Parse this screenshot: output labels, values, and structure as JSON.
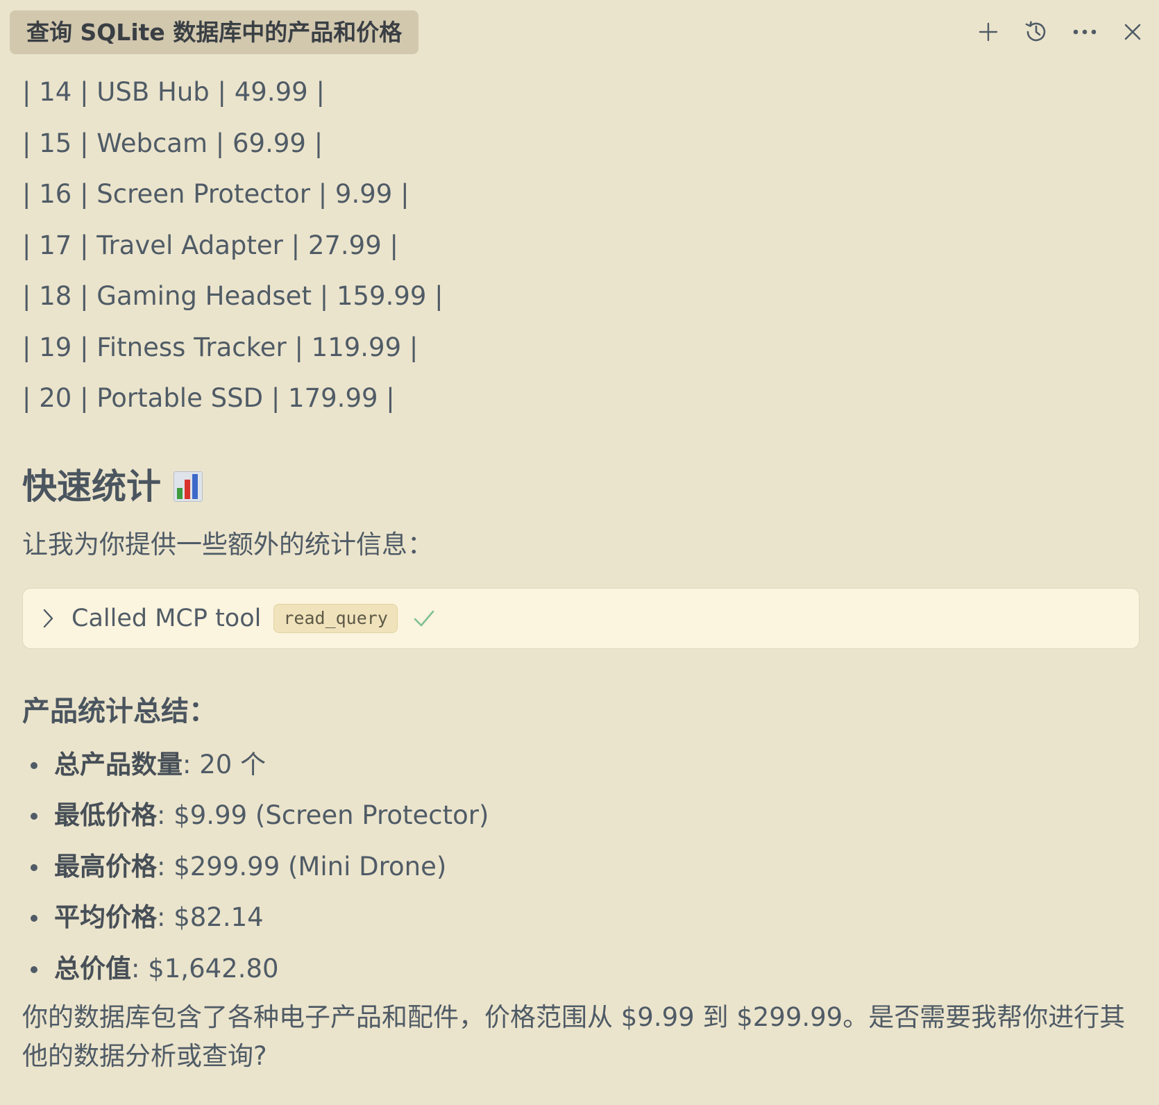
{
  "header": {
    "title": "查询 SQLite 数据库中的产品和价格",
    "icons": [
      "plus-icon",
      "history-icon",
      "more-icon",
      "close-icon"
    ]
  },
  "rows": [
    "| 14 | USB Hub | 49.99 |",
    "| 15 | Webcam | 69.99 |",
    "| 16 | Screen Protector | 9.99 |",
    "| 17 | Travel Adapter | 27.99 |",
    "| 18 | Gaming Headset | 159.99 |",
    "| 19 | Fitness Tracker | 119.99 |",
    "| 20 | Portable SSD | 179.99 |"
  ],
  "section": {
    "heading": "快速统计",
    "heading_icon": "bar-chart-emoji",
    "intro": "让我为你提供一些额外的统计信息："
  },
  "tool_call": {
    "label": "Called MCP tool",
    "tool_name": "read_query",
    "status_icon": "checkmark-icon"
  },
  "summary": {
    "heading": "产品统计总结：",
    "items": [
      {
        "label": "总产品数量",
        "value": ": 20 个"
      },
      {
        "label": "最低价格",
        "value": ": $9.99 (Screen Protector)"
      },
      {
        "label": "最高价格",
        "value": ": $299.99 (Mini Drone)"
      },
      {
        "label": "平均价格",
        "value": ": $82.14"
      },
      {
        "label": "总价值",
        "value": ": $1,642.80"
      }
    ]
  },
  "closing": "你的数据库包含了各种电子产品和配件，价格范围从 $9.99 到 $299.99。是否需要我帮你进行其他的数据分析或查询?",
  "colors": {
    "background": "#ebe4cc",
    "text": "#4f5b66",
    "title_chip": "#d2c8ae",
    "tool_box": "#fbf4df",
    "check": "#7fc08f"
  }
}
